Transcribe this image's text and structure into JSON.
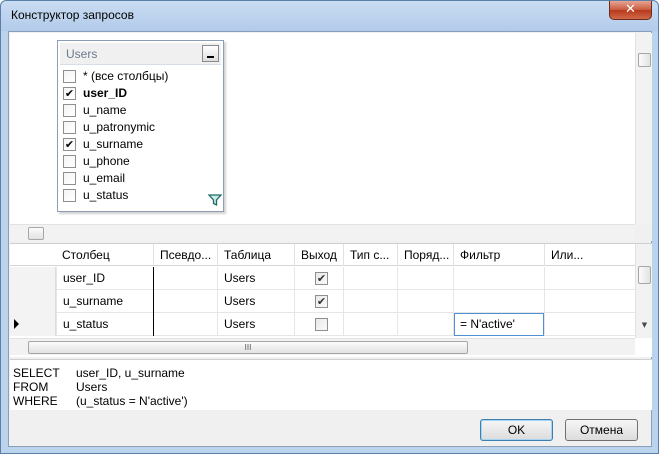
{
  "window": {
    "title": "Конструктор запросов",
    "close_glyph": "✕"
  },
  "diagram": {
    "table": {
      "title": "Users",
      "columns": [
        {
          "label": "* (все столбцы)",
          "checked": false,
          "bold": false
        },
        {
          "label": "user_ID",
          "checked": true,
          "bold": true
        },
        {
          "label": "u_name",
          "checked": false,
          "bold": false
        },
        {
          "label": "u_patronymic",
          "checked": false,
          "bold": false
        },
        {
          "label": "u_surname",
          "checked": true,
          "bold": false
        },
        {
          "label": "u_phone",
          "checked": false,
          "bold": false
        },
        {
          "label": "u_email",
          "checked": false,
          "bold": false
        },
        {
          "label": "u_status",
          "checked": false,
          "bold": false
        }
      ],
      "filter_icon": "filter-funnel-icon"
    }
  },
  "grid": {
    "headers": [
      "Столбец",
      "Псевдо...",
      "Таблица",
      "Выход",
      "Тип с...",
      "Поряд...",
      "Фильтр",
      "Или..."
    ],
    "rows": [
      {
        "column": "user_ID",
        "alias": "",
        "table": "Users",
        "output": true,
        "filter": "",
        "current": false
      },
      {
        "column": "u_surname",
        "alias": "",
        "table": "Users",
        "output": true,
        "filter": "",
        "current": false
      },
      {
        "column": "u_status",
        "alias": "",
        "table": "Users",
        "output": false,
        "filter": "= N'active'",
        "current": true
      }
    ],
    "scroll_grip": "III"
  },
  "sql": {
    "lines": [
      {
        "keyword": "SELECT",
        "value": "user_ID, u_surname"
      },
      {
        "keyword": "FROM",
        "value": "Users"
      },
      {
        "keyword": "WHERE",
        "value": "(u_status = N'active')"
      }
    ]
  },
  "buttons": {
    "ok": "OK",
    "cancel": "Отмена"
  },
  "check_glyph": "✔"
}
